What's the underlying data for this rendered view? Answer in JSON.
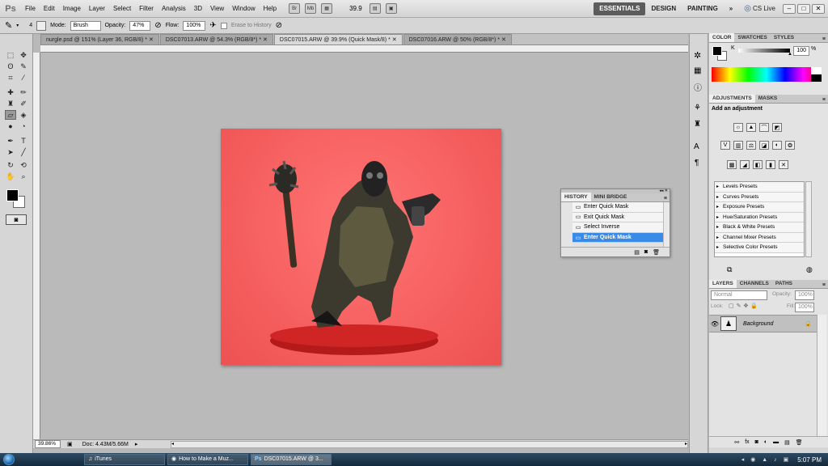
{
  "app": {
    "logo": "Ps"
  },
  "menu": {
    "items": [
      "File",
      "Edit",
      "Image",
      "Layer",
      "Select",
      "Filter",
      "Analysis",
      "3D",
      "View",
      "Window",
      "Help"
    ],
    "br_icon": "Br",
    "mb_icon": "Mb",
    "zoom": "39.9",
    "workspaces": [
      "ESSENTIALS",
      "DESIGN",
      "PAINTING"
    ],
    "more": "»",
    "cs_live": "CS Live"
  },
  "options": {
    "brush_size": "4",
    "mode_label": "Mode:",
    "mode_value": "Brush",
    "opacity_label": "Opacity:",
    "opacity_value": "47%",
    "flow_label": "Flow:",
    "flow_value": "100%",
    "erase_history": "Erase to History"
  },
  "tabs": [
    {
      "label": "nurgle.psd @ 151% (Layer 36, RGB/8) *"
    },
    {
      "label": "DSC07013.ARW @ 54.3% (RGB/8*) *"
    },
    {
      "label": "DSC07015.ARW @ 39.9% (Quick Mask/8) *"
    },
    {
      "label": "DSC07016.ARW @ 50% (RGB/8*) *"
    }
  ],
  "status": {
    "zoom": "39.86%",
    "doc": "Doc: 4.43M/5.66M"
  },
  "history": {
    "tabs": [
      "HISTORY",
      "MINI BRIDGE"
    ],
    "items": [
      "Enter Quick Mask",
      "Exit Quick Mask",
      "Select Inverse",
      "Enter Quick Mask"
    ],
    "selected_index": 3
  },
  "color_panel": {
    "tabs": [
      "COLOR",
      "SWATCHES",
      "STYLES"
    ],
    "k_label": "K",
    "k_value": "100",
    "k_unit": "%"
  },
  "adjustments": {
    "tabs": [
      "ADJUSTMENTS",
      "MASKS"
    ],
    "title": "Add an adjustment",
    "presets": [
      "Levels Presets",
      "Curves Presets",
      "Exposure Presets",
      "Hue/Saturation Presets",
      "Black & White Presets",
      "Channel Mixer Presets",
      "Selective Color Presets"
    ]
  },
  "layers": {
    "tabs": [
      "LAYERS",
      "CHANNELS",
      "PATHS"
    ],
    "blend_mode": "Normal",
    "opacity_label": "Opacity:",
    "opacity_value": "100%",
    "lock_label": "Lock:",
    "fill_label": "Fill:",
    "fill_value": "100%",
    "layer_name": "Background"
  },
  "taskbar": {
    "items": [
      "iTunes",
      "How to Make a Muz...",
      "DSC07015.ARW @ 3..."
    ],
    "clock": "5:07 PM"
  },
  "colors": {
    "mask_red": "#f45b5b",
    "selection_blue": "#3a8be8",
    "workspace_active": "#5c5c5c"
  }
}
